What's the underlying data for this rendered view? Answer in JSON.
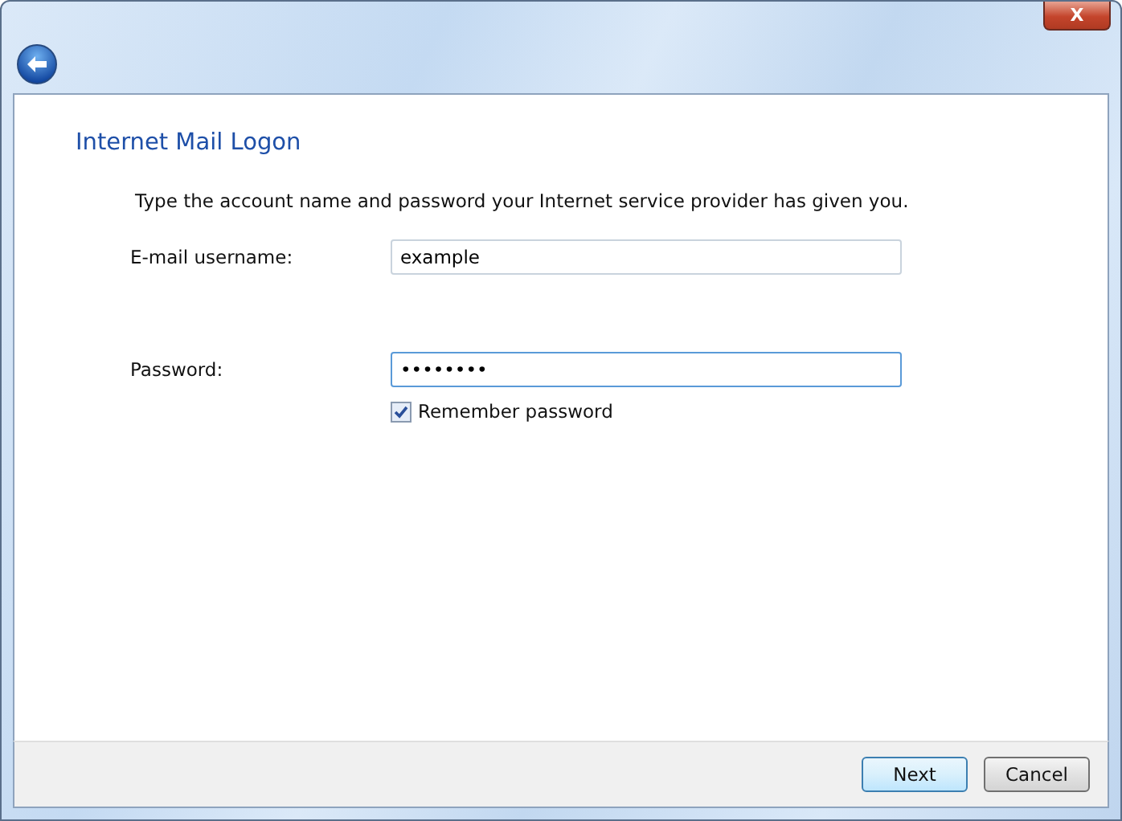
{
  "window": {
    "close_button": "X"
  },
  "heading": "Internet Mail Logon",
  "instructions": "Type the account name and password your Internet service provider has given you.",
  "fields": [
    {
      "label": "E-mail username:",
      "value": "example",
      "focused": false
    },
    {
      "label": "Password:",
      "value": "••••••••",
      "focused": true
    }
  ],
  "remember": {
    "label": "Remember password",
    "checked": true
  },
  "buttons": [
    {
      "label": "Next",
      "default": true
    },
    {
      "label": "Cancel",
      "default": false
    }
  ]
}
